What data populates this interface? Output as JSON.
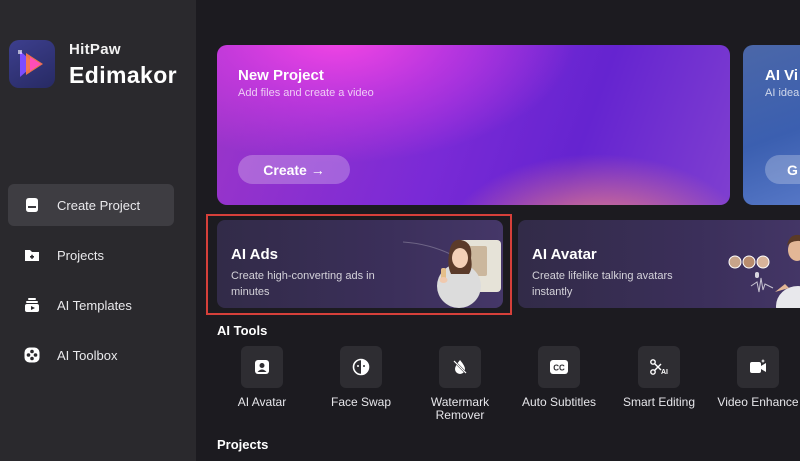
{
  "brand": {
    "name_small": "HitPaw",
    "name_big": "Edimakor"
  },
  "sidebar": {
    "items": [
      {
        "label": "Create Project",
        "icon": "create-project-icon",
        "active": true
      },
      {
        "label": "Projects",
        "icon": "projects-folder-icon"
      },
      {
        "label": "AI Templates",
        "icon": "ai-templates-icon"
      },
      {
        "label": "AI Toolbox",
        "icon": "ai-toolbox-icon"
      }
    ]
  },
  "banners": {
    "new_project": {
      "title": "New Project",
      "subtitle": "Add files and create a video",
      "button": "Create →"
    },
    "ai_video": {
      "title": "AI Vi",
      "subtitle": "AI idea",
      "button": "G"
    }
  },
  "cards": {
    "ai_ads": {
      "title": "AI Ads",
      "subtitle": "Create high-converting ads in minutes"
    },
    "ai_avatar": {
      "title": "AI Avatar",
      "subtitle": "Create lifelike talking avatars instantly"
    }
  },
  "sections": {
    "ai_tools": "AI Tools",
    "projects": "Projects"
  },
  "tools": [
    {
      "label": "AI Avatar",
      "icon": "ai-avatar-icon"
    },
    {
      "label": "Face Swap",
      "icon": "face-swap-icon"
    },
    {
      "label": "Watermark\nRemover",
      "icon": "watermark-remover-icon"
    },
    {
      "label": "Auto Subtitles",
      "icon": "cc-subtitles-icon"
    },
    {
      "label": "Smart Editing",
      "icon": "smart-editing-icon"
    },
    {
      "label": "Video Enhance",
      "icon": "video-enhance-icon"
    }
  ],
  "colors": {
    "highlight": "#d6403a",
    "sidebar_bg": "#2a292d",
    "main_bg": "#1c1b20"
  }
}
